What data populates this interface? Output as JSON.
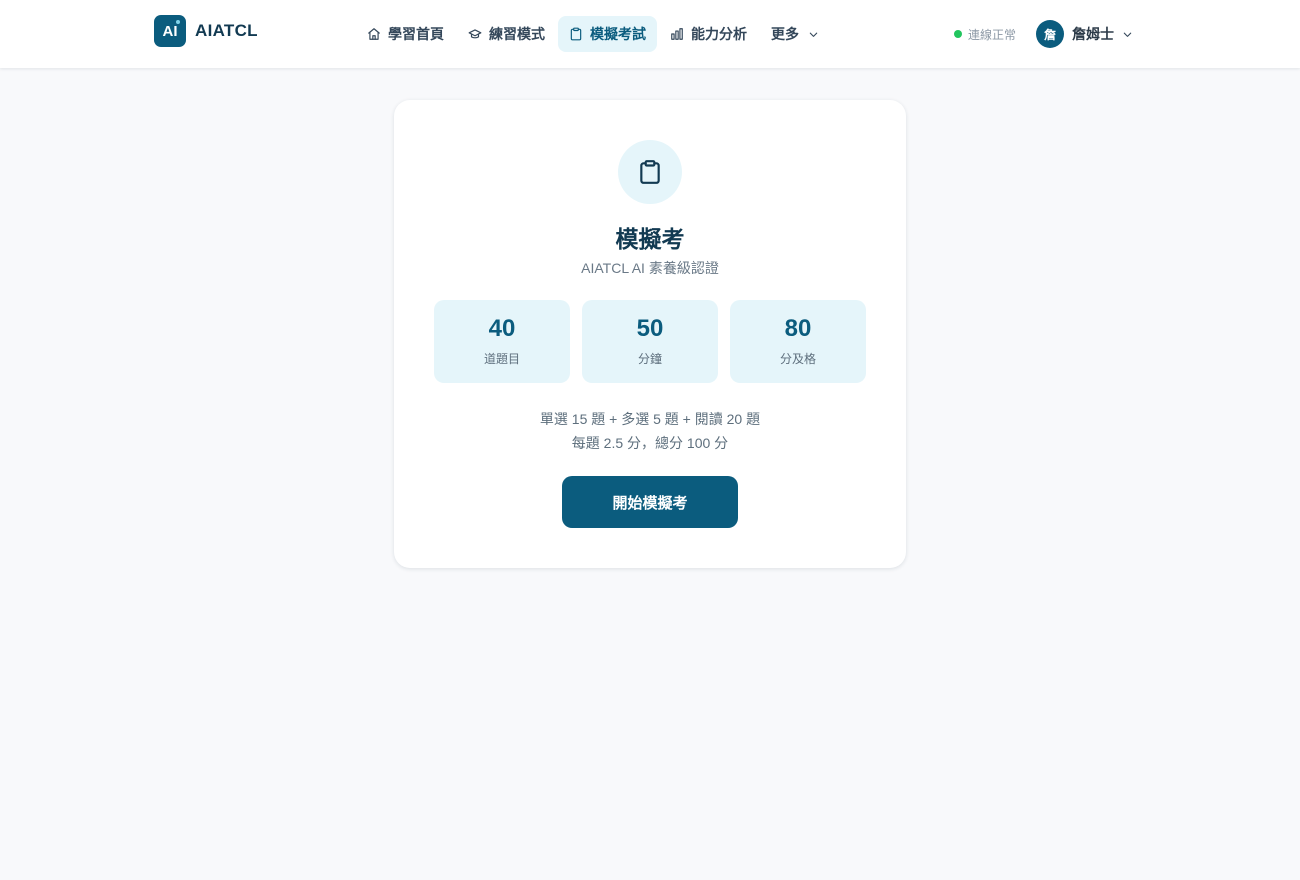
{
  "app": {
    "logo_mark": "AI",
    "name": "AIATCL"
  },
  "nav": {
    "items": [
      {
        "label": "學習首頁",
        "icon": "home-icon",
        "active": false
      },
      {
        "label": "練習模式",
        "icon": "graduation-cap-icon",
        "active": false
      },
      {
        "label": "模擬考試",
        "icon": "clipboard-icon",
        "active": true
      },
      {
        "label": "能力分析",
        "icon": "bar-chart-icon",
        "active": false
      },
      {
        "label": "更多",
        "icon": "chevron-down-icon",
        "active": false
      }
    ]
  },
  "status": {
    "text": "連線正常",
    "color": "#22c55e"
  },
  "user": {
    "avatar_initial": "詹",
    "name": "詹姆士"
  },
  "exam": {
    "icon": "clipboard-icon",
    "title": "模擬考",
    "subtitle": "AIATCL AI 素養級認證",
    "stats": [
      {
        "value": "40",
        "label": "道題目"
      },
      {
        "value": "50",
        "label": "分鐘"
      },
      {
        "value": "80",
        "label": "分及格"
      }
    ],
    "breakdown_line1": "單選 15 題 + 多選 5 題 + 閱讀 20 題",
    "breakdown_line2": "每題 2.5 分，總分 100 分",
    "start_button": "開始模擬考"
  },
  "colors": {
    "brand": "#0b5c7e",
    "brand_light": "#e5f5fa",
    "background": "#f8f9fb"
  }
}
